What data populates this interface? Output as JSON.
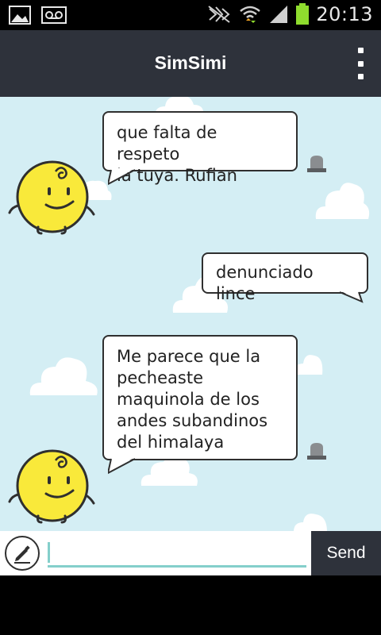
{
  "status_bar": {
    "time": "20:13",
    "icons": [
      "gallery-icon",
      "voicemail-icon",
      "nfc-mute-icon",
      "wifi-icon",
      "signal-icon",
      "battery-icon"
    ]
  },
  "app_bar": {
    "title": "SimSimi",
    "menu_icon": "overflow-menu-icon"
  },
  "colors": {
    "app_bar": "#2e323b",
    "chat_bg": "#d4eef4",
    "accent": "#84cfcb",
    "avatar_yellow": "#f9e93a",
    "battery_green": "#8fdc2e"
  },
  "messages": [
    {
      "sender": "simsimi",
      "text": "que falta de respeto\nla tuya. Rufian",
      "report_icon": "report-siren-icon"
    },
    {
      "sender": "user",
      "text": "denunciado lince"
    },
    {
      "sender": "simsimi",
      "text": "Me parece que la\npecheaste\nmaquinola de los\nandes subandinos\ndel himalaya",
      "report_icon": "report-siren-icon"
    }
  ],
  "composer": {
    "input_value": "",
    "input_placeholder": "",
    "send_label": "Send",
    "edit_icon": "pencil-icon"
  }
}
